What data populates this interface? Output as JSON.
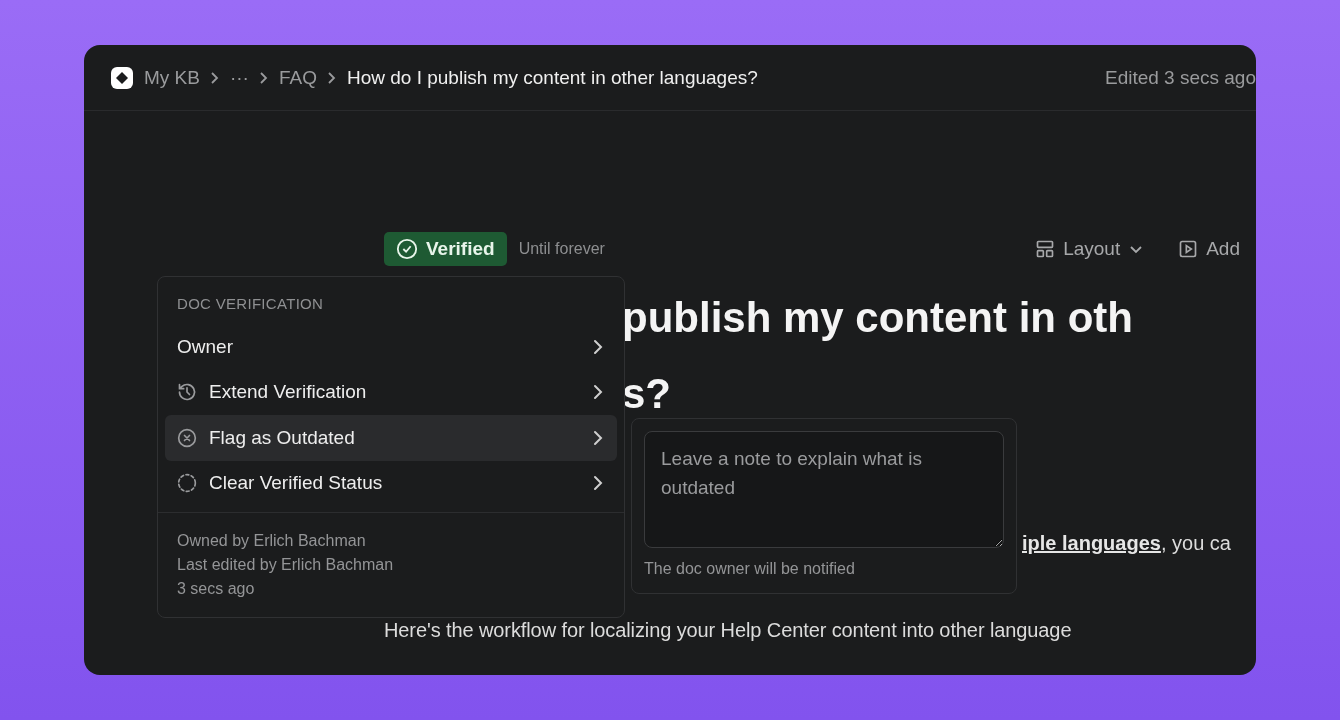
{
  "breadcrumb": {
    "items": [
      "My KB",
      "···",
      "FAQ"
    ],
    "current": "How do I publish my content in other languages?",
    "status": "Edited 3 secs ago"
  },
  "verification": {
    "badge": "Verified",
    "until": "Until forever"
  },
  "toolbar": [
    {
      "label": "Layout",
      "kind": "dropdown"
    },
    {
      "label": "Add",
      "kind": "button"
    }
  ],
  "title_lines": [
    "publish my content in oth",
    "s?"
  ],
  "paragraph": {
    "link": "iple languages",
    "rest": ", you ca"
  },
  "paragraph_2": "Here's the workflow for localizing your Help Center content into other language",
  "menu": {
    "heading": "DOC VERIFICATION",
    "items": [
      {
        "label": "Owner",
        "kind": "plain",
        "selected": false
      },
      {
        "label": "Extend Verification",
        "kind": "history",
        "selected": false
      },
      {
        "label": "Flag as Outdated",
        "kind": "flag",
        "selected": true
      },
      {
        "label": "Clear Verified Status",
        "kind": "clear",
        "selected": false
      }
    ],
    "footer": [
      "Owned by Erlich Bachman",
      "Last edited by Erlich Bachman",
      "3 secs ago"
    ]
  },
  "note_popover": {
    "placeholder": "Leave a note to explain what is outdated",
    "hint": "The doc owner will be notified"
  }
}
